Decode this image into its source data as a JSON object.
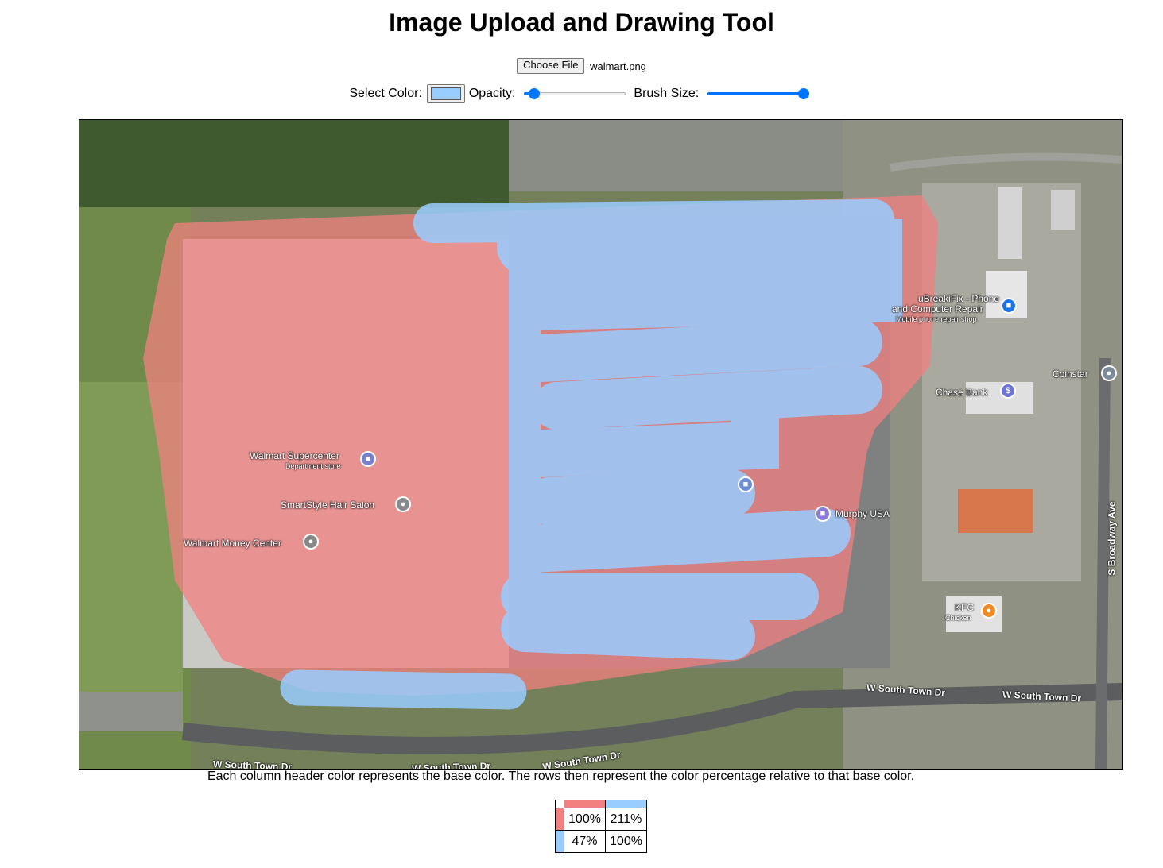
{
  "page": {
    "title": "Image Upload and Drawing Tool"
  },
  "file_input": {
    "button_label": "Choose File",
    "file_name": "walmart.png"
  },
  "controls": {
    "color_label": "Select Color:",
    "selected_color": "#99ccff",
    "opacity_label": "Opacity:",
    "opacity_value": 0.1,
    "brush_label": "Brush Size:",
    "brush_value": 0.95
  },
  "map": {
    "labels": {
      "walmart_supercenter": "Walmart Supercenter",
      "walmart_supercenter_sub": "Department store",
      "smartstyle": "SmartStyle Hair Salon",
      "money_center": "Walmart Money Center",
      "breakifix": "uBreakiFix - Phone",
      "breakifix_2": "and Computer Repair",
      "breakifix_sub": "Mobile phone repair shop",
      "coinstar": "Coinstar",
      "chase": "Chase Bank",
      "murphy": "Murphy USA",
      "kfc": "KFC",
      "kfc_sub": "Chicken",
      "road_south_town_1": "W South Town Dr",
      "road_south_town_2": "W South Town Dr",
      "road_south_town_3": "W South Town Dr",
      "road_south_town_4": "W South Town Dr",
      "road_south_town_5": "W South Town Dr",
      "road_broadway": "S Broadway Ave"
    },
    "annotation_colors": {
      "red": "#f28080",
      "blue": "#99ccff"
    }
  },
  "caption": "Each column header color represents the base color. The rows then represent the color percentage relative to that base color.",
  "matrix": {
    "column_colors": [
      "#f28080",
      "#99ccff"
    ],
    "rows": [
      {
        "color": "#f28080",
        "values": [
          "100%",
          "211%"
        ]
      },
      {
        "color": "#99ccff",
        "values": [
          "47%",
          "100%"
        ]
      }
    ]
  }
}
